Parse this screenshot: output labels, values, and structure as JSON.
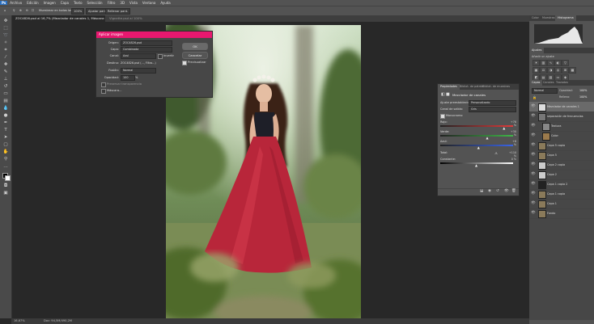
{
  "menubar": {
    "items": [
      "Archivo",
      "Edición",
      "Imagen",
      "Capa",
      "Texto",
      "Selección",
      "Filtro",
      "3D",
      "Vista",
      "Ventana",
      "Ayuda"
    ]
  },
  "optionsbar": {
    "sample_all": "Muestrear en todas las capas",
    "zoom": "100%",
    "fit_screen": "Ajustar pant.",
    "fill_screen": "Rellenar pant."
  },
  "tabs": [
    "ZOC4826.psd al 16,7% (Mezclador de canales 1, Máscara de capa/8) *",
    "Vignette.psd al 100%"
  ],
  "status": {
    "zoom": "16,67%",
    "doc": "Doc: 94,5M/490,2M"
  },
  "dialog": {
    "title": "Aplicar imagen",
    "origin_label": "Origen:",
    "origin_value": "ZOC4826.psd",
    "layer_label": "Capa:",
    "layer_value": "Combinada",
    "channel_label": "Canal:",
    "channel_value": "Azul",
    "invert_label": "Invertir",
    "dest_label": "Destino:",
    "dest_value": "ZOC4826.psd (..., Filtro...)",
    "blending_label": "Fusión:",
    "blending_value": "Normal",
    "opacity_label": "Opacidad:",
    "opacity_value": "100",
    "opacity_unit": "%",
    "preserve_label": "Preservar transparencia",
    "mask_label": "Máscara...",
    "ok": "OK",
    "cancel": "Cancelar",
    "preview": "Previsualizar"
  },
  "properties": {
    "tabs": [
      "Propiedades",
      "Bibliot. de patrón",
      "Bibliot. de muestras"
    ],
    "header": "Mezclador de canales",
    "preset_label": "Ajuste preestablecido:",
    "preset_value": "Personalizado",
    "output_label": "Canal de salida:",
    "output_value": "Gris",
    "monochrome": "Monocromo",
    "red_label": "Rojo:",
    "red_value": "+76 %",
    "green_label": "Verde:",
    "green_value": "+30 %",
    "blue_label": "Azul:",
    "blue_value": "+6 %",
    "total_label": "Total:",
    "total_value": "+110 %",
    "constant_label": "Constante:",
    "constant_value": "0 %",
    "red_pos": 0.88,
    "green_pos": 0.65,
    "blue_pos": 0.53,
    "total_pos": 0.77,
    "constant_pos": 0.5,
    "colors": {
      "red": "#e03a3a",
      "green": "#3fb648",
      "blue": "#3a64e6"
    }
  },
  "panels": {
    "top_tabs": [
      "Color",
      "Muestras",
      "Histograma"
    ],
    "adj_title": "Ajustes",
    "adj_subtitle": "Añadir un ajuste",
    "layers_tabs": [
      "Capas",
      "Canales",
      "Trazados"
    ],
    "blend_mode": "Normal",
    "opacity_label": "Opacidad:",
    "opacity_value": "100%",
    "fill_label": "Relleno:",
    "fill_value": "100%"
  },
  "layers": [
    "Mezclador de canales 1",
    "separación de frecuencias",
    "Textura",
    "Color",
    "Capa 5 copia",
    "Capa 5",
    "Capa 2 copia",
    "Capa 2",
    "Capa 1 copia 2",
    "Capa 1 copia",
    "Capa 1",
    "Fondo"
  ]
}
